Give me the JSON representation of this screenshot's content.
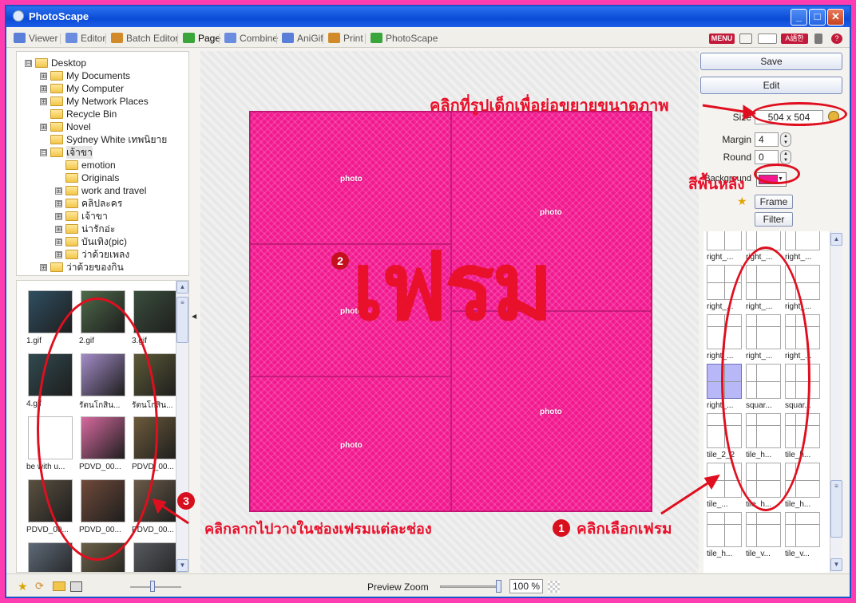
{
  "window": {
    "title": "PhotoScape"
  },
  "tabs": [
    {
      "label": "Viewer",
      "color": "#5a7fd8"
    },
    {
      "label": "Editor",
      "color": "#6a8de0"
    },
    {
      "label": "Batch Editor",
      "color": "#d08a2a"
    },
    {
      "label": "Page",
      "color": "#3aa53a"
    },
    {
      "label": "Combine",
      "color": "#6a8de0"
    },
    {
      "label": "AniGif",
      "color": "#5a7fd8"
    },
    {
      "label": "Print",
      "color": "#d08a2a"
    },
    {
      "label": "PhotoScape",
      "color": "#3aa53a"
    }
  ],
  "toolbar_right": {
    "menu_label": "MENU",
    "lang_label": "A語한"
  },
  "tree": [
    {
      "label": "Desktop",
      "pm": "⊟"
    },
    {
      "label": "My Documents",
      "pm": "⊞"
    },
    {
      "label": "My Computer",
      "pm": "⊞"
    },
    {
      "label": "My Network Places",
      "pm": "⊞"
    },
    {
      "label": "Recycle Bin",
      "pm": ""
    },
    {
      "label": "Novel",
      "pm": "⊞"
    },
    {
      "label": "Sydney White เทพนิยาย",
      "pm": ""
    },
    {
      "label": "เจ้าขา",
      "pm": "⊟"
    },
    {
      "label": "emotion",
      "pm": ""
    },
    {
      "label": "Originals",
      "pm": ""
    },
    {
      "label": "work and travel",
      "pm": "⊞"
    },
    {
      "label": "คลิปละคร",
      "pm": "⊞"
    },
    {
      "label": "เจ้าขา",
      "pm": "⊞"
    },
    {
      "label": "น่ารักอ่ะ",
      "pm": "⊞"
    },
    {
      "label": "บันเทิง(pic)",
      "pm": "⊞"
    },
    {
      "label": "ว่าด้วยเพลง",
      "pm": "⊞"
    },
    {
      "label": "ว่าด้วยของกิน",
      "pm": "⊞"
    }
  ],
  "thumbnails": [
    {
      "caption": "1.gif",
      "color": "#2f4f62"
    },
    {
      "caption": "2.gif",
      "color": "#4e6b4a"
    },
    {
      "caption": "3.gif",
      "color": "#3a4d3c"
    },
    {
      "caption": "4.gif",
      "color": "#304a50"
    },
    {
      "caption": "รัตนโกสิน...",
      "color": "#a48cc8"
    },
    {
      "caption": "รัตนโกสิน...",
      "color": "#5c5a36"
    },
    {
      "caption": "be with u...",
      "color": "#ffffff"
    },
    {
      "caption": "PDVD_00...",
      "color": "#d86aa0"
    },
    {
      "caption": "PDVD_00...",
      "color": "#6c5a3a"
    },
    {
      "caption": "PDVD_00...",
      "color": "#5a5040"
    },
    {
      "caption": "PDVD_00...",
      "color": "#704a3a"
    },
    {
      "caption": "PDVD_00...",
      "color": "#6a5a48"
    },
    {
      "caption": "",
      "color": "#5f6a78"
    },
    {
      "caption": "",
      "color": "#6a6048"
    },
    {
      "caption": "",
      "color": "#585a60"
    }
  ],
  "canvas": {
    "photo_label": "photo",
    "overlay_text": "เฟรม",
    "background_color": "#f2188f"
  },
  "panel": {
    "save_label": "Save",
    "edit_label": "Edit",
    "size_label": "Size",
    "size_value": "504 x 504",
    "margin_label": "Margin",
    "margin_value": "4",
    "round_label": "Round",
    "round_value": "0",
    "background_label": "Background",
    "frame_label": "Frame",
    "filter_label": "Filter"
  },
  "frames": [
    {
      "caption": "right_..."
    },
    {
      "caption": "right_..."
    },
    {
      "caption": "right_..."
    },
    {
      "caption": "right_..."
    },
    {
      "caption": "right_..."
    },
    {
      "caption": "right_..."
    },
    {
      "caption": "right_..."
    },
    {
      "caption": "right_..."
    },
    {
      "caption": "right_..."
    },
    {
      "caption": "right_...",
      "highlight": true
    },
    {
      "caption": "squar..."
    },
    {
      "caption": "squar..."
    },
    {
      "caption": "tile_2_2"
    },
    {
      "caption": "tile_h..."
    },
    {
      "caption": "tile_h..."
    },
    {
      "caption": "tile_..."
    },
    {
      "caption": "tile_h..."
    },
    {
      "caption": "tile_h..."
    },
    {
      "caption": "tile_h..."
    },
    {
      "caption": "tile_v..."
    },
    {
      "caption": "tile_v..."
    }
  ],
  "bottom": {
    "preview_zoom_label": "Preview Zoom",
    "zoom_value": "100 %"
  },
  "annotations": {
    "resize_note": "คลิกที่รูปเด็กเพื่อย่อขยายขนาดภาพ",
    "background_note": "สีพื้นหลัง",
    "drag_note": "คลิกลากไปวางในช่องเฟรมแต่ละช่อง",
    "select_frame_note": "คลิกเลือกเฟรม",
    "step1": "1",
    "step2": "2",
    "step3": "3"
  }
}
